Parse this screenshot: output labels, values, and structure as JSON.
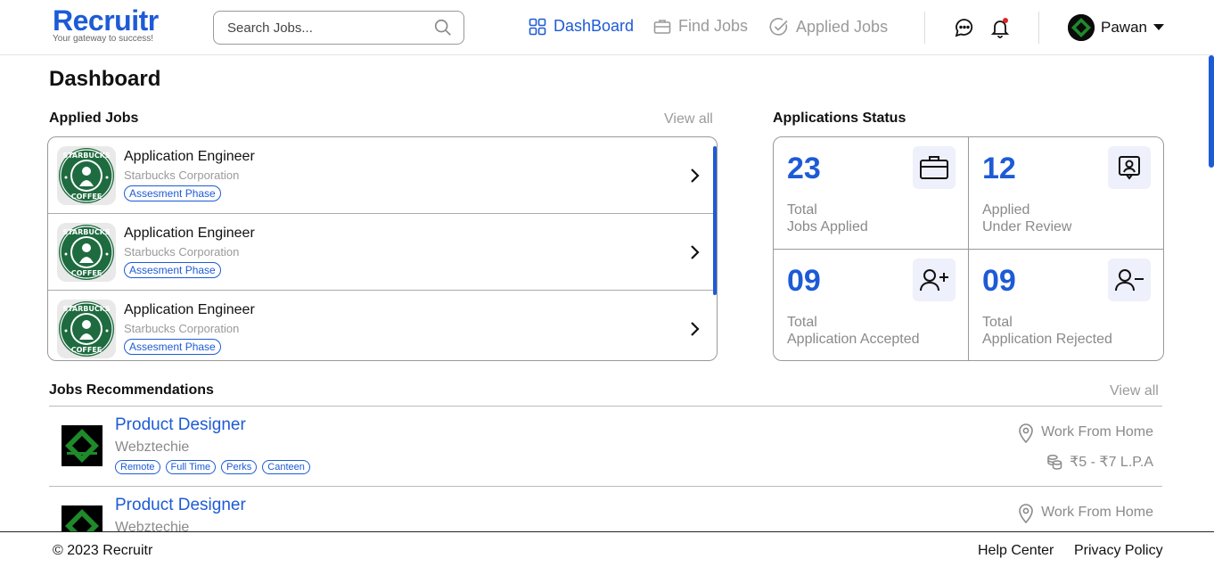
{
  "header": {
    "logo_name": "Recruitr",
    "logo_tagline": "Your gateway to success!",
    "search_placeholder": "Search Jobs...",
    "nav": [
      {
        "label": "DashBoard",
        "icon": "grid-icon",
        "active": true
      },
      {
        "label": "Find Jobs",
        "icon": "briefcase-icon",
        "active": false
      },
      {
        "label": "Applied Jobs",
        "icon": "check-circle-icon",
        "active": false
      }
    ],
    "user_name": "Pawan"
  },
  "page_title": "Dashboard",
  "applied_jobs": {
    "title": "Applied Jobs",
    "view_all": "View all",
    "items": [
      {
        "title": "Application Engineer",
        "company": "Starbucks Corporation",
        "phase": "Assesment Phase"
      },
      {
        "title": "Application Engineer",
        "company": "Starbucks Corporation",
        "phase": "Assesment Phase"
      },
      {
        "title": "Application Engineer",
        "company": "Starbucks Corporation",
        "phase": "Assesment Phase"
      }
    ]
  },
  "status": {
    "title": "Applications Status",
    "cards": [
      {
        "value": "23",
        "line1": "Total",
        "line2": "Jobs Applied",
        "icon": "briefcase-icon"
      },
      {
        "value": "12",
        "line1": "Applied",
        "line2": "Under Review",
        "icon": "user-review-icon"
      },
      {
        "value": "09",
        "line1": "Total",
        "line2": "Application Accepted",
        "icon": "user-plus-icon"
      },
      {
        "value": "09",
        "line1": "Total",
        "line2": "Application Rejected",
        "icon": "user-minus-icon"
      }
    ]
  },
  "recommendations": {
    "title": "Jobs Recommendations",
    "view_all": "View all",
    "items": [
      {
        "title": "Product Designer",
        "company": "Webztechie",
        "tags": [
          "Remote",
          "Full Time",
          "Perks",
          "Canteen"
        ],
        "location": "Work From Home",
        "salary": "₹5 - ₹7 L.P.A"
      },
      {
        "title": "Product Designer",
        "company": "Webztechie",
        "tags": [],
        "location": "Work From Home",
        "salary": ""
      }
    ]
  },
  "footer": {
    "copyright": "© 2023 Recruitr",
    "help": "Help Center",
    "privacy": "Privacy Policy"
  },
  "colors": {
    "accent": "#1d5bd6",
    "muted": "#9a9a9a",
    "icon_bg": "#eef0fb"
  }
}
